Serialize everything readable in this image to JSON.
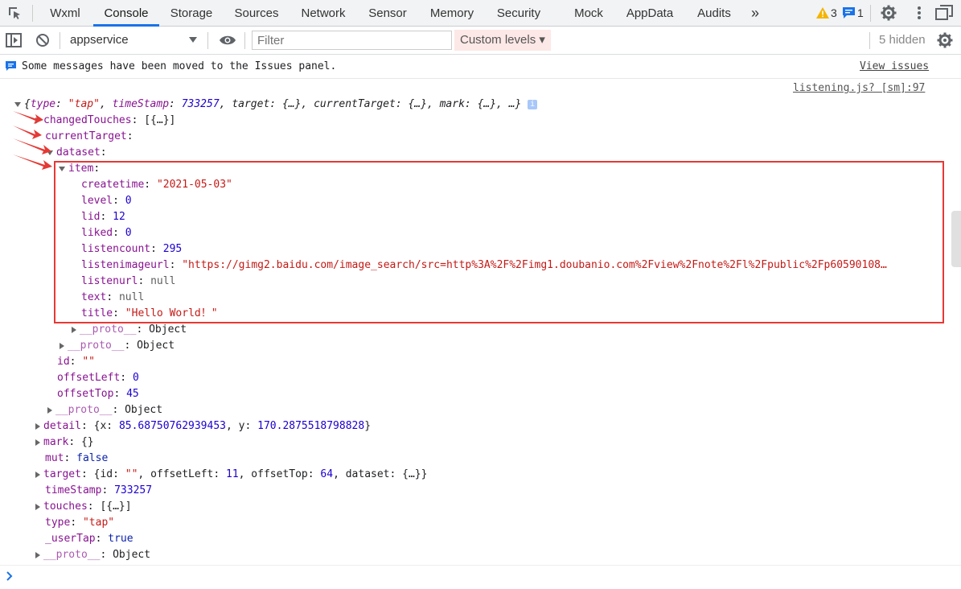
{
  "tabs": {
    "wxml": "Wxml",
    "console": "Console",
    "storage": "Storage",
    "sources": "Sources",
    "network": "Network",
    "sensor": "Sensor",
    "memory": "Memory",
    "security": "Security",
    "mock": "Mock",
    "appdata": "AppData",
    "audits": "Audits",
    "more": "»"
  },
  "counters": {
    "warnings": "3",
    "messages": "1"
  },
  "toolbar": {
    "context": "appservice",
    "filter_placeholder": "Filter",
    "levels": "Custom levels ▾",
    "hidden": "5 hidden"
  },
  "banner": {
    "message": "Some messages have been moved to the Issues panel.",
    "link": "View issues"
  },
  "source_link": "listening.js? [sm]:97",
  "log": {
    "summary": {
      "open": "{",
      "type_key": "type",
      "type_val": "\"tap\"",
      "ts_key": "timeStamp",
      "ts_val": "733257",
      "rest": ", target: {…}, currentTarget: {…}, mark: {…}, …}"
    },
    "changedTouches": {
      "key": "changedTouches",
      "val": "[{…}]"
    },
    "currentTarget": {
      "key": "currentTarget"
    },
    "dataset": {
      "key": "dataset"
    },
    "item": {
      "key": "item"
    },
    "item_props": {
      "createtime_k": "createtime",
      "createtime_v": "\"2021-05-03\"",
      "level_k": "level",
      "level_v": "0",
      "lid_k": "lid",
      "lid_v": "12",
      "liked_k": "liked",
      "liked_v": "0",
      "listencount_k": "listencount",
      "listencount_v": "295",
      "listenimageurl_k": "listenimageurl",
      "listenimageurl_v": "\"https://gimg2.baidu.com/image_search/src=http%3A%2F%2Fimg1.doubanio.com%2Fview%2Fnote%2Fl%2Fpublic%2Fp60590108…",
      "listenurl_k": "listenurl",
      "listenurl_v": "null",
      "text_k": "text",
      "text_v": "null",
      "title_k": "title",
      "title_v": "\"Hello World！\""
    },
    "proto_key": "__proto__",
    "proto_val": "Object",
    "ct_props": {
      "id_k": "id",
      "id_v": "\"\"",
      "offsetLeft_k": "offsetLeft",
      "offsetLeft_v": "0",
      "offsetTop_k": "offsetTop",
      "offsetTop_v": "45"
    },
    "detail": {
      "key": "detail",
      "x_v": "85.68750762939453",
      "y_v": "170.2875518798828"
    },
    "mark": {
      "key": "mark",
      "val": "{}"
    },
    "mut": {
      "key": "mut",
      "val": "false"
    },
    "target": {
      "key": "target",
      "id_v": "\"\"",
      "offsetLeft_v": "11",
      "offsetTop_v": "64",
      "rest": "dataset: {…}}"
    },
    "timeStamp": {
      "key": "timeStamp",
      "val": "733257"
    },
    "touches": {
      "key": "touches",
      "val": "[{…}]"
    },
    "type": {
      "key": "type",
      "val": "\"tap\""
    },
    "userTap": {
      "key": "_userTap",
      "val": "true"
    }
  },
  "colors": {
    "accent": "#1a73e8",
    "highlight": "#e53935",
    "key": "#881391",
    "string": "#c41a16",
    "number": "#1c00cf"
  }
}
